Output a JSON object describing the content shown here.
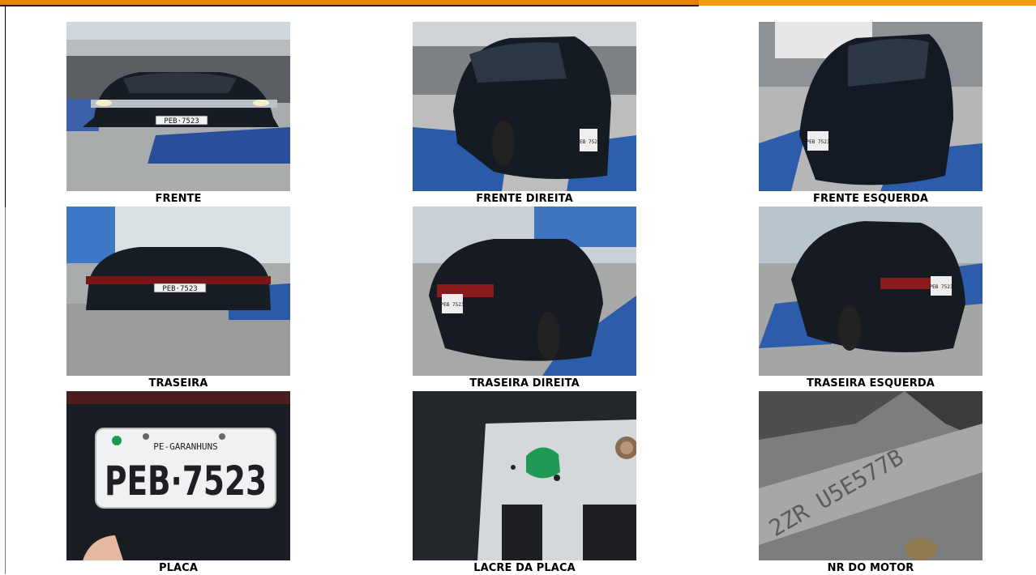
{
  "photos": [
    {
      "key": "front",
      "caption": "FRENTE",
      "plate": "PEB·7523"
    },
    {
      "key": "front-right",
      "caption": "FRENTE DIREITA",
      "plate": "PEB 7523"
    },
    {
      "key": "front-left",
      "caption": "FRENTE ESQUERDA",
      "plate": "PEB 7523"
    },
    {
      "key": "rear",
      "caption": "TRASEIRA",
      "plate": "PEB·7523"
    },
    {
      "key": "rear-right",
      "caption": "TRASEIRA DIREITA",
      "plate": "PEB 7523"
    },
    {
      "key": "rear-left",
      "caption": "TRASEIRA ESQUERDA",
      "plate": "PEB 7523"
    },
    {
      "key": "plate",
      "caption": "PLACA",
      "plate": "PEB·7523",
      "plate_city": "PE-GARANHUNS"
    },
    {
      "key": "plate-seal",
      "caption": "LACRE DA PLACA"
    },
    {
      "key": "engine-number",
      "caption": "NR DO MOTOR",
      "engine_text": "2ZR  U5E577B"
    }
  ]
}
